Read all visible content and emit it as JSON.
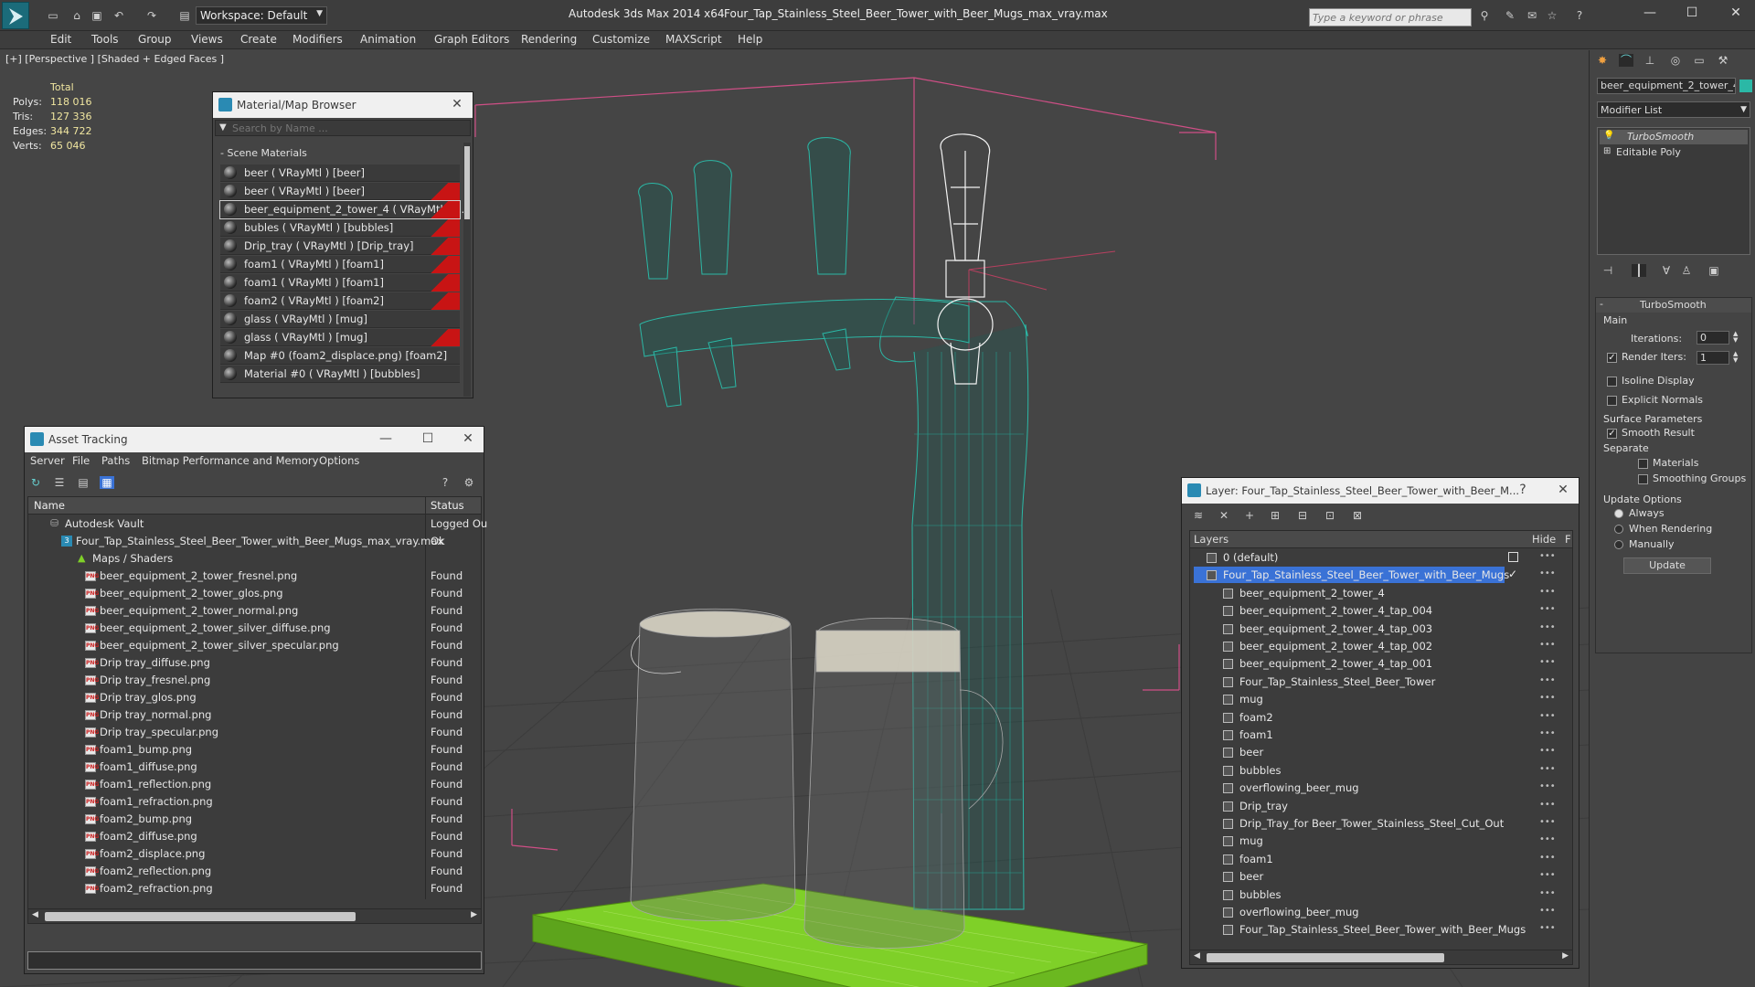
{
  "app": {
    "title": "Autodesk 3ds Max  2014 x64",
    "file": "Four_Tap_Stainless_Steel_Beer_Tower_with_Beer_Mugs_max_vray.max",
    "workspace": "Workspace: Default",
    "search_placeholder": "Type a keyword or phrase"
  },
  "menu": [
    "Edit",
    "Tools",
    "Group",
    "Views",
    "Create",
    "Modifiers",
    "Animation",
    "Graph Editors",
    "Rendering",
    "Customize",
    "MAXScript",
    "Help"
  ],
  "viewport": {
    "label": "[+] [Perspective ] [Shaded + Edged Faces ]",
    "stats": {
      "header": "Total",
      "rows": [
        {
          "label": "Polys:",
          "value": "118 016"
        },
        {
          "label": "Tris:",
          "value": "127 336"
        },
        {
          "label": "Edges:",
          "value": "344 722"
        },
        {
          "label": "Verts:",
          "value": "65 046"
        }
      ]
    }
  },
  "material_browser": {
    "title": "Material/Map Browser",
    "search_placeholder": "Search by Name ...",
    "section": "- Scene Materials",
    "items": [
      {
        "label": "beer  ( VRayMtl )  [beer]",
        "red": false
      },
      {
        "label": "beer  ( VRayMtl )  [beer]",
        "red": true
      },
      {
        "label": "beer_equipment_2_tower_4  ( VRayMtl ) [...",
        "red": true,
        "selected": true
      },
      {
        "label": "bubles  ( VRayMtl )  [bubbles]",
        "red": true
      },
      {
        "label": "Drip_tray  ( VRayMtl )  [Drip_tray]",
        "red": true
      },
      {
        "label": "foam1  ( VRayMtl )  [foam1]",
        "red": true
      },
      {
        "label": "foam1  ( VRayMtl )  [foam1]",
        "red": true
      },
      {
        "label": "foam2  ( VRayMtl )  [foam2]",
        "red": true
      },
      {
        "label": "glass  ( VRayMtl )  [mug]",
        "red": false
      },
      {
        "label": "glass  ( VRayMtl )  [mug]",
        "red": true
      },
      {
        "label": "Map #0 (foam2_displace.png)  [foam2]",
        "red": false
      },
      {
        "label": "Material #0  ( VRayMtl )  [bubbles]",
        "red": false
      }
    ]
  },
  "asset_tracking": {
    "title": "Asset Tracking",
    "menu": [
      "Server",
      "File",
      "Paths",
      "Bitmap Performance and Memory",
      "Options"
    ],
    "col_name": "Name",
    "col_status": "Status",
    "rows": [
      {
        "name": "Autodesk Vault",
        "status": "Logged Ou",
        "indent": 1,
        "type": "vault"
      },
      {
        "name": "Four_Tap_Stainless_Steel_Beer_Tower_with_Beer_Mugs_max_vray.max",
        "status": "Ok",
        "indent": 2,
        "type": "max"
      },
      {
        "name": "Maps / Shaders",
        "status": "",
        "indent": 3,
        "type": "folder"
      },
      {
        "name": "beer_equipment_2_tower_fresnel.png",
        "status": "Found",
        "indent": 4,
        "type": "png"
      },
      {
        "name": "beer_equipment_2_tower_glos.png",
        "status": "Found",
        "indent": 4,
        "type": "png"
      },
      {
        "name": "beer_equipment_2_tower_normal.png",
        "status": "Found",
        "indent": 4,
        "type": "png"
      },
      {
        "name": "beer_equipment_2_tower_silver_diffuse.png",
        "status": "Found",
        "indent": 4,
        "type": "png"
      },
      {
        "name": "beer_equipment_2_tower_silver_specular.png",
        "status": "Found",
        "indent": 4,
        "type": "png"
      },
      {
        "name": "Drip tray_diffuse.png",
        "status": "Found",
        "indent": 4,
        "type": "png"
      },
      {
        "name": "Drip tray_fresnel.png",
        "status": "Found",
        "indent": 4,
        "type": "png"
      },
      {
        "name": "Drip tray_glos.png",
        "status": "Found",
        "indent": 4,
        "type": "png"
      },
      {
        "name": "Drip tray_normal.png",
        "status": "Found",
        "indent": 4,
        "type": "png"
      },
      {
        "name": "Drip tray_specular.png",
        "status": "Found",
        "indent": 4,
        "type": "png"
      },
      {
        "name": "foam1_bump.png",
        "status": "Found",
        "indent": 4,
        "type": "png"
      },
      {
        "name": "foam1_diffuse.png",
        "status": "Found",
        "indent": 4,
        "type": "png"
      },
      {
        "name": "foam1_reflection.png",
        "status": "Found",
        "indent": 4,
        "type": "png"
      },
      {
        "name": "foam1_refraction.png",
        "status": "Found",
        "indent": 4,
        "type": "png"
      },
      {
        "name": "foam2_bump.png",
        "status": "Found",
        "indent": 4,
        "type": "png"
      },
      {
        "name": "foam2_diffuse.png",
        "status": "Found",
        "indent": 4,
        "type": "png"
      },
      {
        "name": "foam2_displace.png",
        "status": "Found",
        "indent": 4,
        "type": "png"
      },
      {
        "name": "foam2_reflection.png",
        "status": "Found",
        "indent": 4,
        "type": "png"
      },
      {
        "name": "foam2_refraction.png",
        "status": "Found",
        "indent": 4,
        "type": "png"
      }
    ]
  },
  "layers": {
    "title": "Layer: Four_Tap_Stainless_Steel_Beer_Tower_with_Beer_M...",
    "help": "?",
    "col_layers": "Layers",
    "col_hide": "Hide",
    "col_f": "F",
    "rows": [
      {
        "name": "0 (default)",
        "level": 0,
        "type": "layer"
      },
      {
        "name": "Four_Tap_Stainless_Steel_Beer_Tower_with_Beer_Mugs",
        "level": 0,
        "type": "layer",
        "selected": true
      },
      {
        "name": "beer_equipment_2_tower_4",
        "level": 1,
        "type": "obj"
      },
      {
        "name": "beer_equipment_2_tower_4_tap_004",
        "level": 1,
        "type": "obj"
      },
      {
        "name": "beer_equipment_2_tower_4_tap_003",
        "level": 1,
        "type": "obj"
      },
      {
        "name": "beer_equipment_2_tower_4_tap_002",
        "level": 1,
        "type": "obj"
      },
      {
        "name": "beer_equipment_2_tower_4_tap_001",
        "level": 1,
        "type": "obj"
      },
      {
        "name": "Four_Tap_Stainless_Steel_Beer_Tower",
        "level": 1,
        "type": "obj"
      },
      {
        "name": "mug",
        "level": 1,
        "type": "obj"
      },
      {
        "name": "foam2",
        "level": 1,
        "type": "obj"
      },
      {
        "name": "foam1",
        "level": 1,
        "type": "obj"
      },
      {
        "name": "beer",
        "level": 1,
        "type": "obj"
      },
      {
        "name": "bubbles",
        "level": 1,
        "type": "obj"
      },
      {
        "name": "overflowing_beer_mug",
        "level": 1,
        "type": "obj"
      },
      {
        "name": "Drip_tray",
        "level": 1,
        "type": "obj"
      },
      {
        "name": "Drip_Tray_for Beer_Tower_Stainless_Steel_Cut_Out",
        "level": 1,
        "type": "obj"
      },
      {
        "name": "mug",
        "level": 1,
        "type": "obj"
      },
      {
        "name": "foam1",
        "level": 1,
        "type": "obj"
      },
      {
        "name": "beer",
        "level": 1,
        "type": "obj"
      },
      {
        "name": "bubbles",
        "level": 1,
        "type": "obj"
      },
      {
        "name": "overflowing_beer_mug",
        "level": 1,
        "type": "obj"
      },
      {
        "name": "Four_Tap_Stainless_Steel_Beer_Tower_with_Beer_Mugs",
        "level": 1,
        "type": "obj"
      }
    ]
  },
  "command_panel": {
    "object_name": "beer_equipment_2_tower_4",
    "modifier_list": "Modifier List",
    "stack": [
      "TurboSmooth",
      "Editable Poly"
    ],
    "turbosmooth": {
      "title": "TurboSmooth",
      "main": "Main",
      "iterations_label": "Iterations:",
      "iterations": "0",
      "render_iters_label": "Render Iters:",
      "render_iters": "1",
      "isoline": "Isoline Display",
      "explicit_normals": "Explicit Normals",
      "surface_params": "Surface Parameters",
      "smooth_result": "Smooth Result",
      "separate": "Separate",
      "materials": "Materials",
      "smoothing_groups": "Smoothing Groups",
      "update_options": "Update Options",
      "always": "Always",
      "when_rendering": "When Rendering",
      "manually": "Manually",
      "update_button": "Update"
    }
  },
  "colors": {
    "wire_teal": "#2bb8a6",
    "wire_white": "#f2f2f2",
    "tray_green": "#7fd028",
    "grid_pink": "#d0508a",
    "select_blue": "#3a72d6"
  }
}
